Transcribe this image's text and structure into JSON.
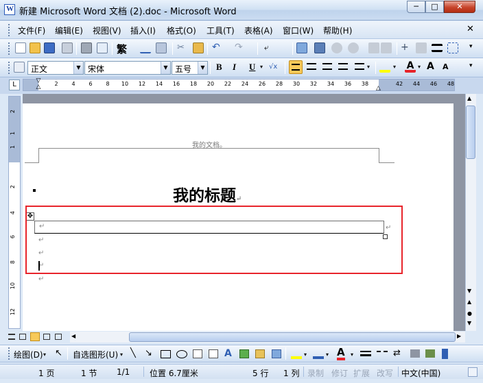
{
  "window": {
    "title": "新建 Microsoft Word 文档 (2).doc - Microsoft Word",
    "minimize": "─",
    "maximize": "□",
    "close": "✕"
  },
  "menu": {
    "items": [
      "文件(F)",
      "编辑(E)",
      "视图(V)",
      "插入(I)",
      "格式(O)",
      "工具(T)",
      "表格(A)",
      "窗口(W)",
      "帮助(H)"
    ],
    "close": "✕"
  },
  "format_toolbar": {
    "style": "正文",
    "font": "宋体",
    "size": "五号",
    "bold": "B",
    "italic": "I",
    "underline": "U",
    "traditional": "繁",
    "font_grow": "A",
    "font_shrink": "A"
  },
  "ruler": {
    "labels": [
      "2",
      "2",
      "4",
      "6",
      "8",
      "10",
      "12",
      "14",
      "16",
      "18",
      "20",
      "22",
      "24",
      "26",
      "28",
      "30",
      "32",
      "34",
      "36",
      "38",
      "42",
      "44",
      "46",
      "48"
    ],
    "vlabels": [
      "2",
      "1",
      "1",
      "2",
      "4",
      "6",
      "8",
      "10",
      "12"
    ],
    "corner": "L"
  },
  "document": {
    "header_text": "我的文档。",
    "title": "我的标题",
    "para_mark": "↵",
    "table_handle": "✥"
  },
  "draw_toolbar": {
    "draw_label": "绘图(D)",
    "autoshape_label": "自选图形(U)",
    "font_color": "A"
  },
  "statusbar": {
    "page": "1 页",
    "section": "1 节",
    "pages": "1/1",
    "position": "位置 6.7厘米",
    "line": "5 行",
    "column": "1 列",
    "rec": "录制",
    "trk": "修订",
    "ext": "扩展",
    "ovr": "改写",
    "language": "中文(中国)"
  },
  "colors": {
    "highlight": "#ffff00",
    "font_color": "#e8242b",
    "selection_box": "#e8242b"
  }
}
